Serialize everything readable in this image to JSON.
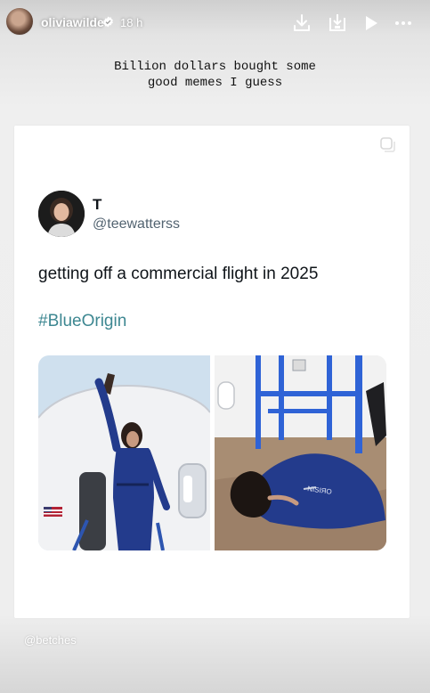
{
  "header": {
    "username": "oliviawilde",
    "time": "18 h",
    "icons": [
      "download-icon",
      "save-icon",
      "play-icon",
      "more-icon"
    ]
  },
  "caption": {
    "line1": "Billion dollars bought some",
    "line2": "good memes I guess"
  },
  "tweet": {
    "name": "T",
    "handle": "@teewatterss",
    "text": "getting off a commercial flight in 2025",
    "hashtag": "#BlueOrigin",
    "media_left_alt": "woman raising arm at capsule door",
    "media_right_alt": "woman kneeling to kiss the ground"
  },
  "watermark": "@betches",
  "colors": {
    "accent_link": "#3d8791",
    "text_primary": "#0f1419",
    "text_secondary": "#536471",
    "suit_blue": "#233b8c"
  }
}
